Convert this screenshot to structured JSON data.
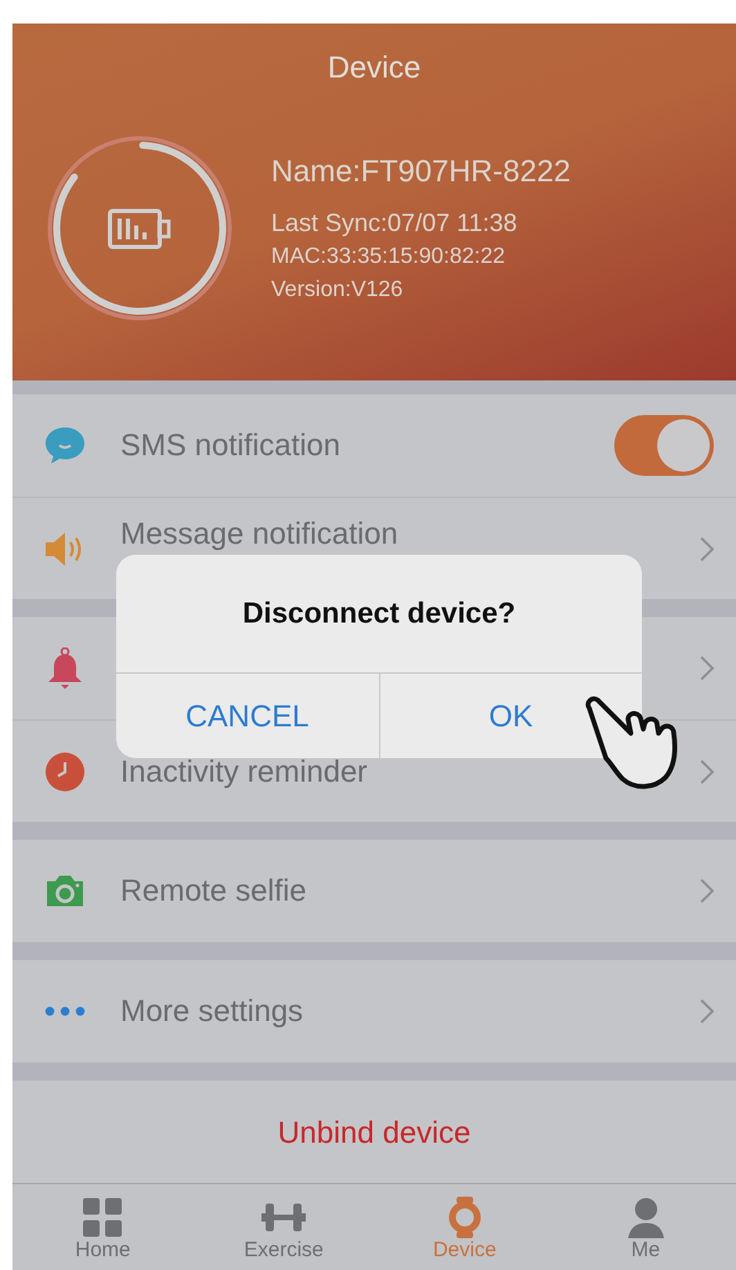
{
  "header": {
    "title": "Device",
    "battery": {
      "level": 0.85
    },
    "name": "Name:FT907HR-8222",
    "last_sync": "Last Sync:07/07 11:38",
    "mac": "MAC:33:35:15:90:82:22",
    "version": "Version:V126"
  },
  "groups": [
    [
      {
        "kind": "toggle",
        "label": "SMS notification",
        "on": true
      },
      {
        "kind": "link",
        "label": "Message notification"
      }
    ],
    [
      {
        "kind": "link"
      },
      {
        "kind": "link",
        "label": "Inactivity reminder"
      }
    ],
    [
      {
        "kind": "link",
        "label": "Remote selfie"
      }
    ],
    [
      {
        "kind": "link",
        "label": "More settings"
      }
    ]
  ],
  "unbind": "Unbind device",
  "tabs": [
    {
      "label": "Home",
      "selected": false
    },
    {
      "label": "Exercise",
      "selected": false
    },
    {
      "label": "Device",
      "selected": true
    },
    {
      "label": "Me",
      "selected": false
    }
  ],
  "dialog": {
    "title": "Disconnect device?",
    "buttons": [
      "CANCEL",
      "OK"
    ]
  }
}
